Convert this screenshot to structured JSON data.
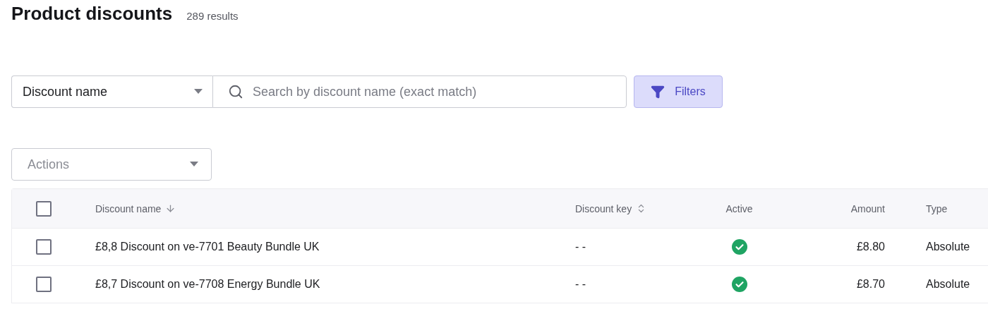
{
  "page": {
    "title": "Product discounts",
    "result_count": "289 results"
  },
  "search": {
    "field_select": "Discount name",
    "placeholder": "Search by discount name (exact match)",
    "filters_button": "Filters"
  },
  "actions": {
    "label": "Actions"
  },
  "table": {
    "select_all": {
      "checked": false
    },
    "columns": [
      {
        "label": "Discount name",
        "sortable": true,
        "sorted": true
      },
      {
        "label": "Discount key",
        "sortable": true,
        "sorted": false
      },
      {
        "label": "Active",
        "sortable": false
      },
      {
        "label": "Amount",
        "sortable": false
      },
      {
        "label": "Type",
        "sortable": false
      }
    ],
    "rows": [
      {
        "checked": false,
        "name": "£8,8 Discount on ve-7701 Beauty Bundle UK",
        "key": "- -",
        "active": true,
        "amount": "£8.80",
        "type": "Absolute"
      },
      {
        "checked": false,
        "name": "£8,7 Discount on ve-7708 Energy Bundle UK",
        "key": "- -",
        "active": true,
        "amount": "£8.70",
        "type": "Absolute"
      }
    ]
  }
}
